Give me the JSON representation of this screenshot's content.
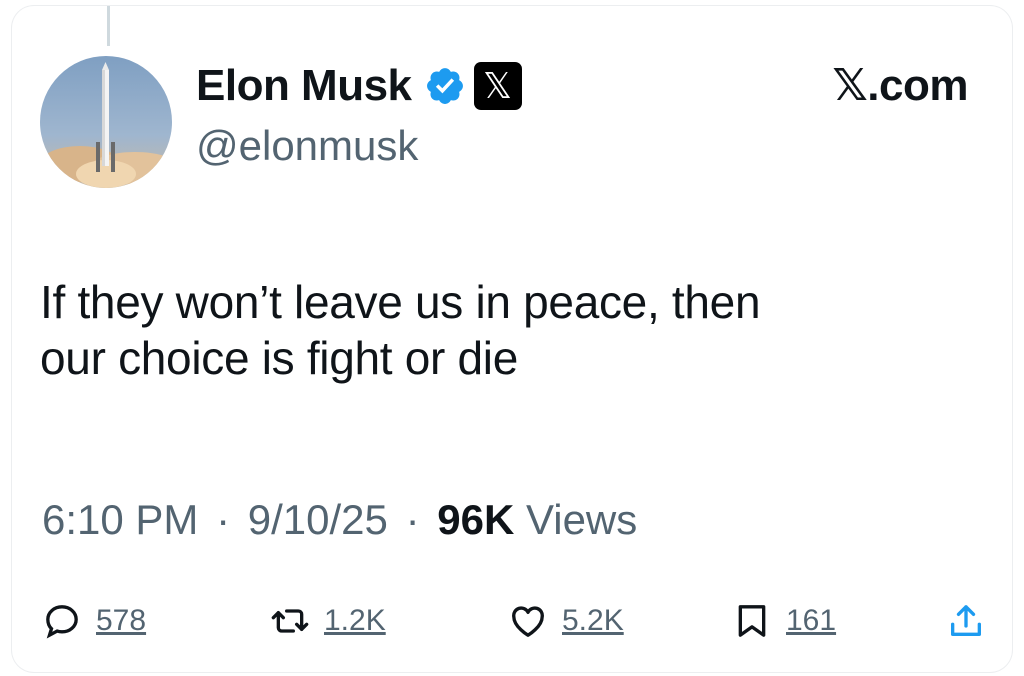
{
  "tweet": {
    "author_name": "Elon Musk",
    "handle": "@elonmusk",
    "site": "𝕏.com",
    "x_badge": "𝕏",
    "text_line1": "If they won’t leave us in peace, then",
    "text_line2": "our choice is fight or die",
    "time": "6:10 PM",
    "date": "9/10/25",
    "views_count": "96K",
    "views_label": "Views",
    "separator": "·"
  },
  "actions": {
    "replies": "578",
    "reposts": "1.2K",
    "likes": "5.2K",
    "bookmarks": "161"
  },
  "icons": {
    "verified": "verified-badge-icon",
    "x_logo": "x-logo-icon",
    "reply": "reply-icon",
    "repost": "repost-icon",
    "like": "heart-icon",
    "bookmark": "bookmark-icon",
    "share": "share-icon"
  },
  "colors": {
    "verified_blue": "#1d9bf0",
    "secondary_text": "#536471",
    "primary_text": "#0f1419"
  }
}
